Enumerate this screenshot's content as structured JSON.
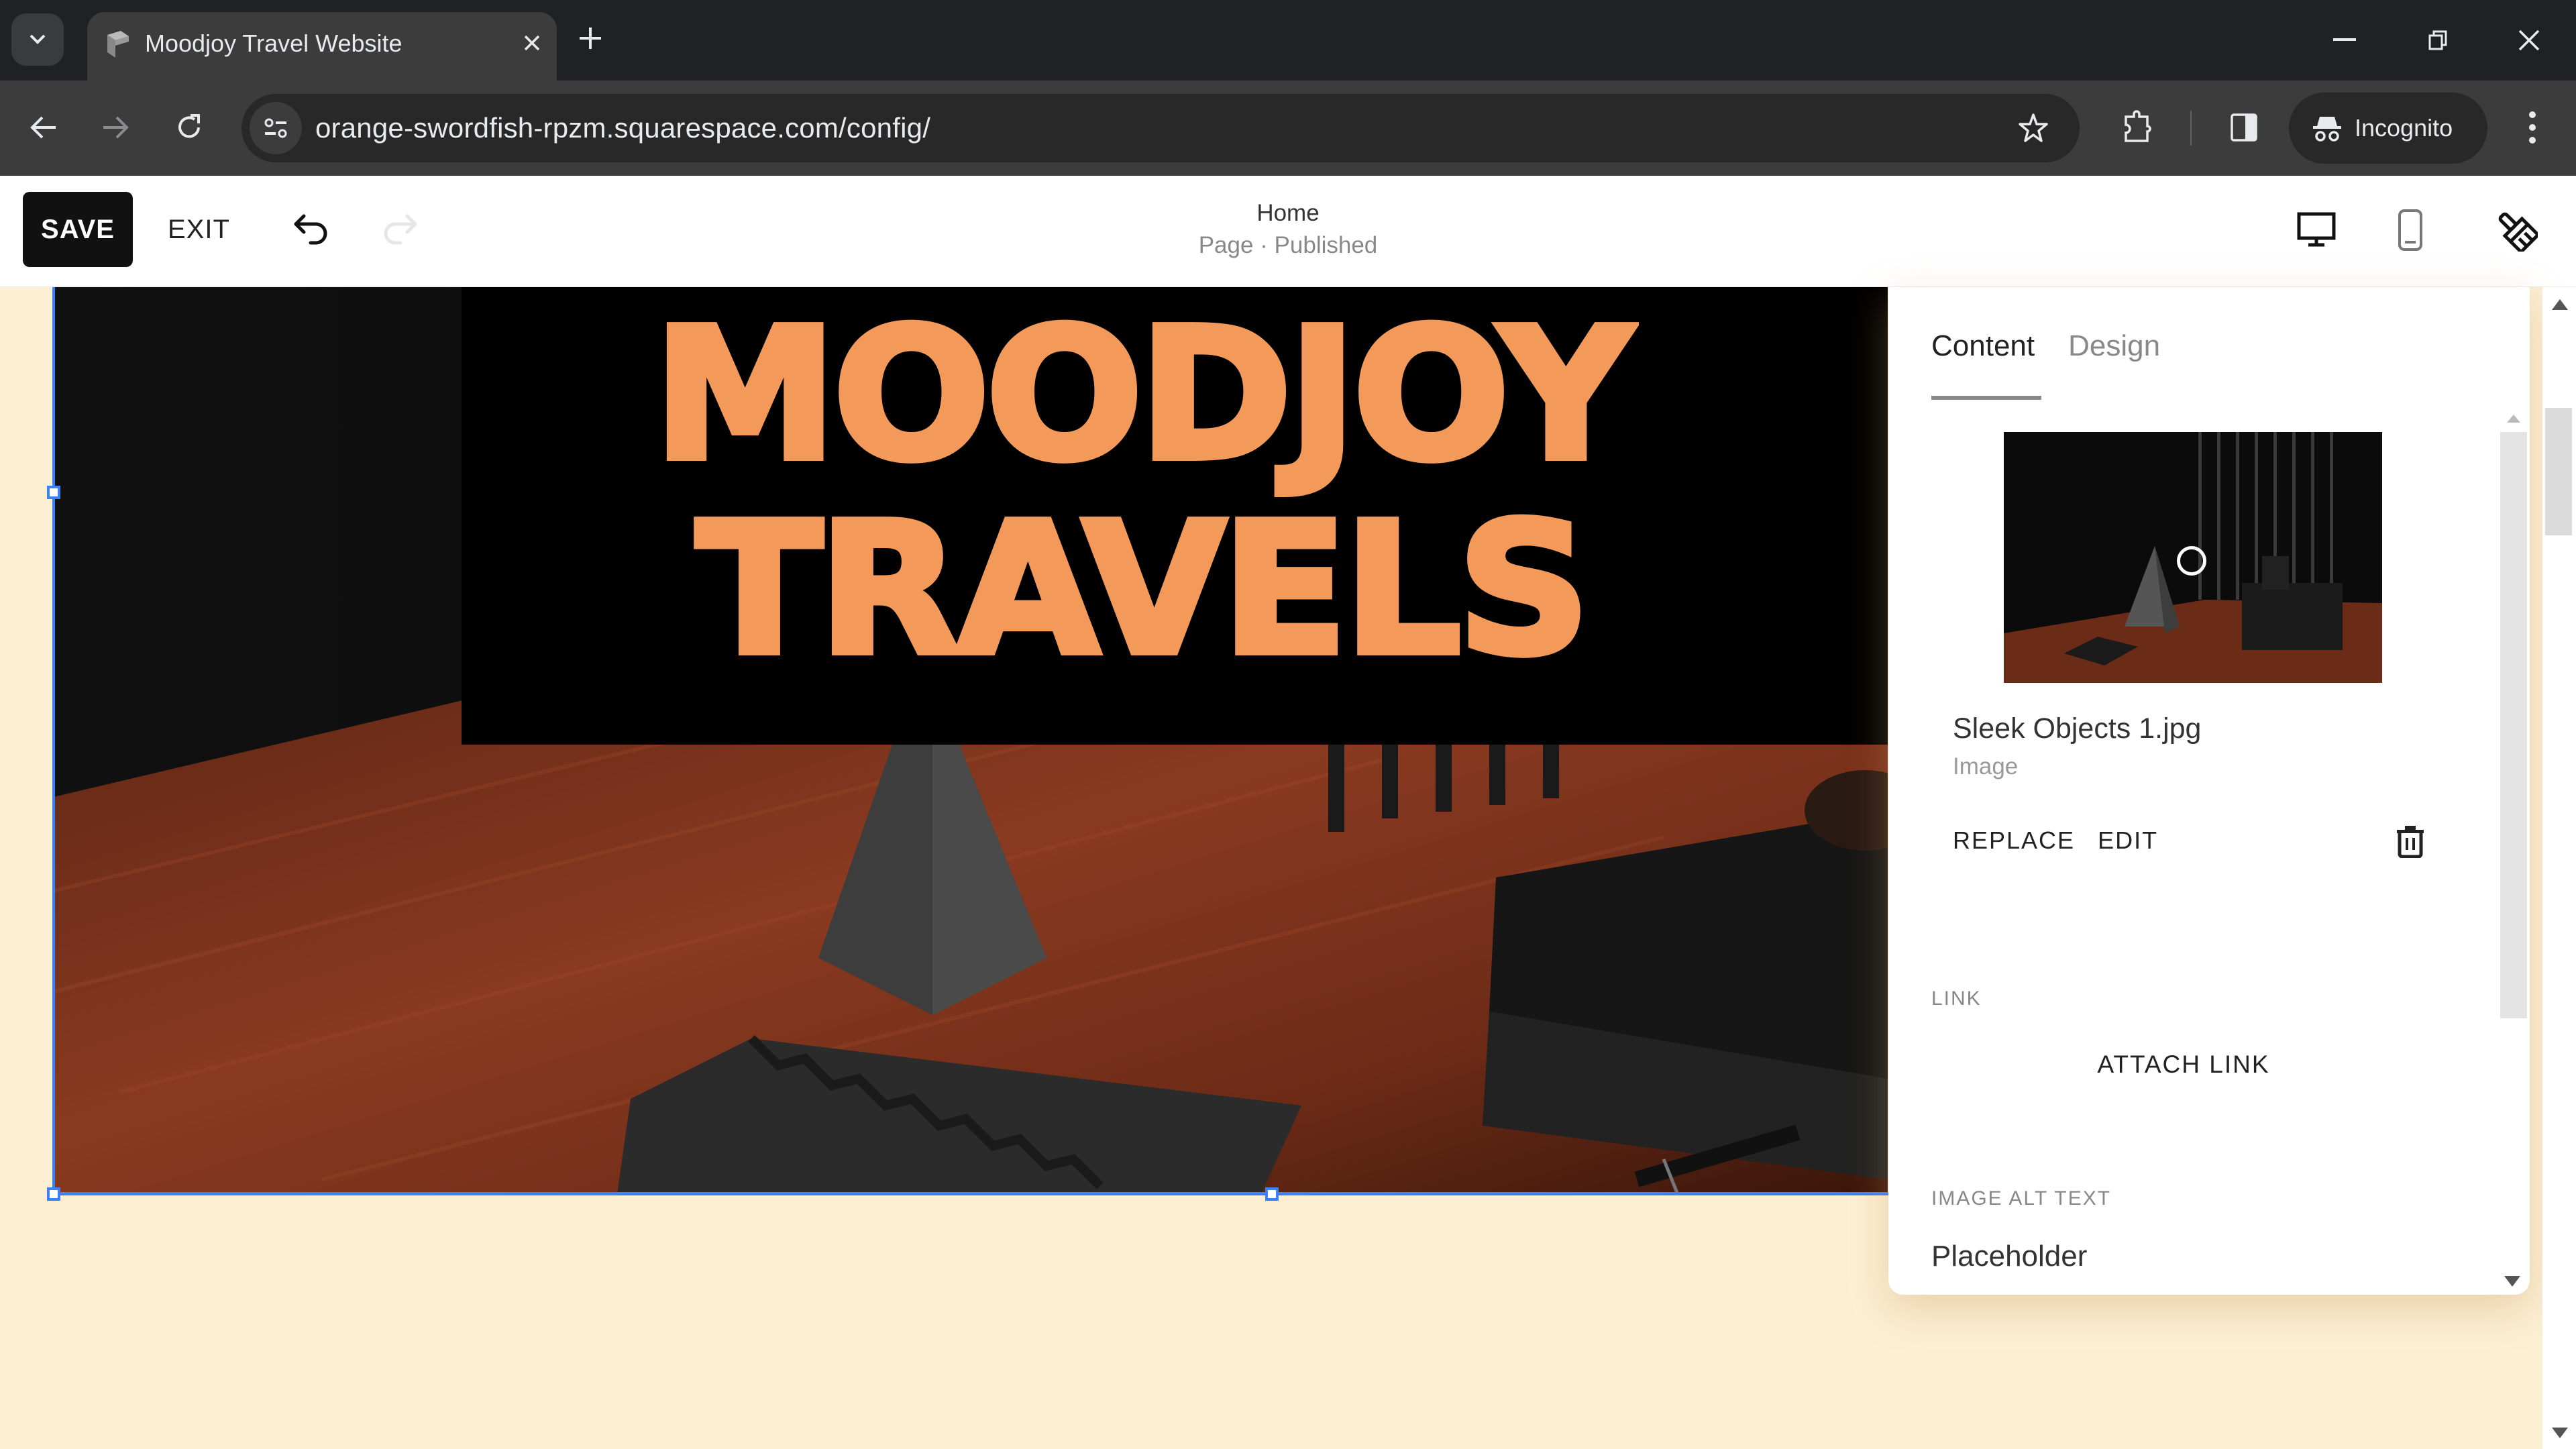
{
  "browser": {
    "tab": {
      "title": "Moodjoy Travel Website",
      "favicon": "squarespace-cube-icon",
      "close_icon": "close-icon"
    },
    "new_tab_icon": "plus-icon",
    "tab_search_icon": "chevron-down-icon",
    "window_controls": [
      "minimize-icon",
      "restore-icon",
      "close-icon"
    ],
    "url": "orange-swordfish-rpzm.squarespace.com/config/",
    "incognito_label": "Incognito",
    "toolbar_icons": [
      "back-icon",
      "forward-icon",
      "reload-icon",
      "site-info-icon",
      "bookmark-star-icon",
      "extensions-icon",
      "side-panel-icon",
      "incognito-icon",
      "more-menu-icon"
    ]
  },
  "editor": {
    "save_label": "SAVE",
    "exit_label": "EXIT",
    "undo_icon": "undo-icon",
    "redo_icon": "redo-icon",
    "page_name": "Home",
    "page_status": "Page · Published",
    "view_icons": [
      "desktop-view-icon",
      "mobile-view-icon",
      "site-styles-brush-icon"
    ]
  },
  "canvas": {
    "hero_title_lines": [
      "MOODJOY",
      "TRAVELS"
    ],
    "colors": {
      "hero_title": "#f39a5a",
      "page_background": "#fcefd3",
      "selection": "#3b82f6"
    }
  },
  "panel": {
    "tabs": [
      {
        "label": "Content",
        "active": true
      },
      {
        "label": "Design",
        "active": false
      }
    ],
    "image": {
      "file_name": "Sleek Objects 1.jpg",
      "file_type": "Image",
      "replace_label": "REPLACE",
      "edit_label": "EDIT",
      "delete_icon": "trash-icon"
    },
    "link": {
      "section_label": "LINK",
      "attach_label": "ATTACH LINK"
    },
    "alt_text": {
      "section_label": "IMAGE ALT TEXT",
      "value": "Placeholder"
    }
  }
}
